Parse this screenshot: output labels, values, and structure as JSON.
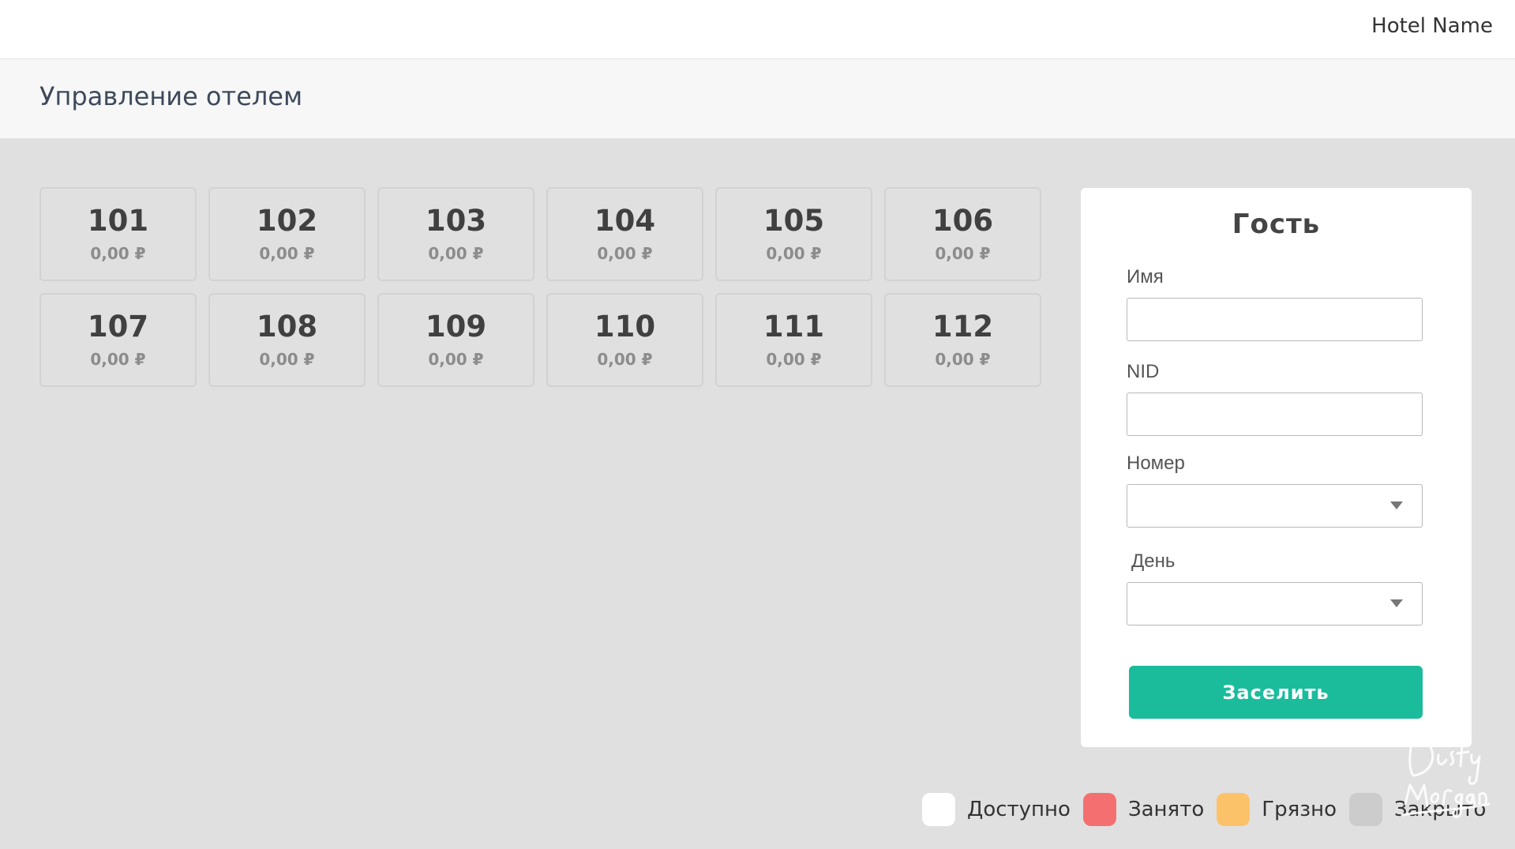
{
  "header": {
    "hotel_name": "Hotel Name"
  },
  "page": {
    "title": "Управление отелем"
  },
  "rooms": [
    {
      "number": "101",
      "price": "0,00 ₽"
    },
    {
      "number": "102",
      "price": "0,00 ₽"
    },
    {
      "number": "103",
      "price": "0,00 ₽"
    },
    {
      "number": "104",
      "price": "0,00 ₽"
    },
    {
      "number": "105",
      "price": "0,00 ₽"
    },
    {
      "number": "106",
      "price": "0,00 ₽"
    },
    {
      "number": "107",
      "price": "0,00 ₽"
    },
    {
      "number": "108",
      "price": "0,00 ₽"
    },
    {
      "number": "109",
      "price": "0,00 ₽"
    },
    {
      "number": "110",
      "price": "0,00 ₽"
    },
    {
      "number": "111",
      "price": "0,00 ₽"
    },
    {
      "number": "112",
      "price": "0,00 ₽"
    }
  ],
  "guest_form": {
    "title": "Гость",
    "name_label": "Имя",
    "name_value": "",
    "nid_label": "NID",
    "nid_value": "",
    "room_label": "Номер",
    "room_value": "",
    "day_label": "День",
    "day_value": "",
    "submit_label": "Заселить"
  },
  "legend": [
    {
      "label": "Доступно",
      "color": "#ffffff"
    },
    {
      "label": "Занято",
      "color": "#f47070"
    },
    {
      "label": "Грязно",
      "color": "#fcc26a"
    },
    {
      "label": "Закрыто",
      "color": "#cccccc"
    }
  ],
  "colors": {
    "accent": "#1abc9c",
    "background": "#e0e0e0"
  },
  "watermark": {
    "text_line1": "Dusty",
    "text_line2": "Morgan"
  }
}
